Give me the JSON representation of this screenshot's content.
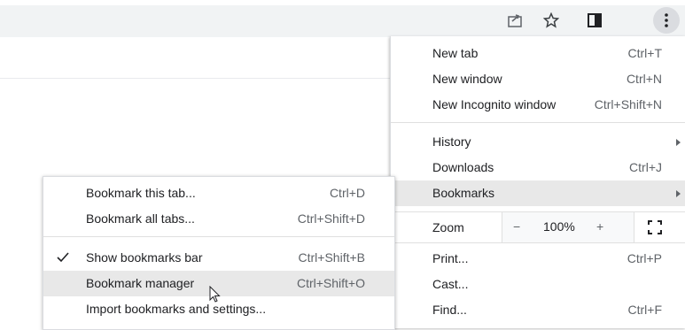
{
  "toolbar": {
    "icons": [
      "share-icon",
      "star-icon",
      "side-panel-icon",
      "kebab-menu-icon"
    ]
  },
  "main_menu": {
    "items": [
      {
        "label": "New tab",
        "shortcut": "Ctrl+T"
      },
      {
        "label": "New window",
        "shortcut": "Ctrl+N"
      },
      {
        "label": "New Incognito window",
        "shortcut": "Ctrl+Shift+N"
      },
      {
        "label": "History",
        "shortcut": ""
      },
      {
        "label": "Downloads",
        "shortcut": "Ctrl+J"
      },
      {
        "label": "Bookmarks",
        "shortcut": ""
      },
      {
        "label": "Print...",
        "shortcut": "Ctrl+P"
      },
      {
        "label": "Cast...",
        "shortcut": ""
      },
      {
        "label": "Find...",
        "shortcut": "Ctrl+F"
      }
    ],
    "zoom": {
      "label": "Zoom",
      "minus": "−",
      "value": "100%",
      "plus": "+"
    }
  },
  "bookmarks_submenu": {
    "items": [
      {
        "label": "Bookmark this tab...",
        "shortcut": "Ctrl+D"
      },
      {
        "label": "Bookmark all tabs...",
        "shortcut": "Ctrl+Shift+D"
      },
      {
        "label": "Show bookmarks bar",
        "shortcut": "Ctrl+Shift+B",
        "checked": true
      },
      {
        "label": "Bookmark manager",
        "shortcut": "Ctrl+Shift+O"
      },
      {
        "label": "Import bookmarks and settings...",
        "shortcut": ""
      }
    ]
  },
  "colors": {
    "highlight": "#e8e8e8",
    "toolbar_bg": "#f1f3f4"
  }
}
